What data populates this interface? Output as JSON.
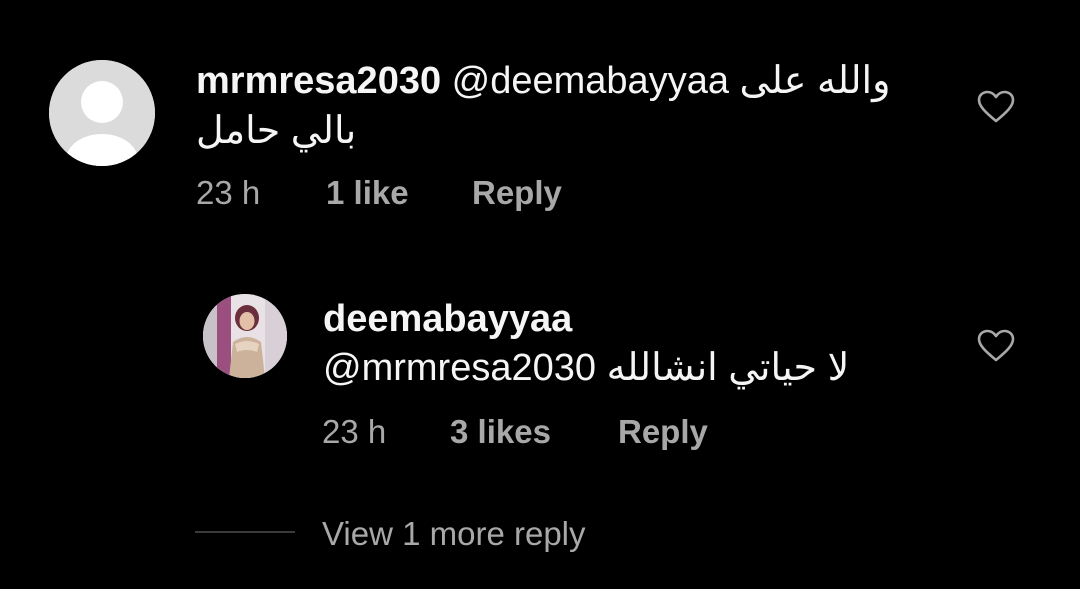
{
  "comment": {
    "username": "mrmresa2030",
    "mention": "@deemabayyaa",
    "text_line1": "والله على",
    "text_line2": "بالي حامل",
    "time": "23 h",
    "likes": "1 like",
    "reply_label": "Reply",
    "avatar_icon": "default-avatar-icon",
    "like_icon": "heart-outline-icon"
  },
  "reply": {
    "username": "deemabayyaa",
    "text": "لا حياتي انشالله",
    "mention": "@mrmresa2030",
    "time": "23 h",
    "likes": "3 likes",
    "reply_label": "Reply",
    "like_icon": "heart-outline-icon"
  },
  "view_more": "View 1 more reply",
  "colors": {
    "background": "#000000",
    "primary_text": "#f5f5f5",
    "secondary_text": "#a8a8a8",
    "divider": "#3a3a3a"
  }
}
